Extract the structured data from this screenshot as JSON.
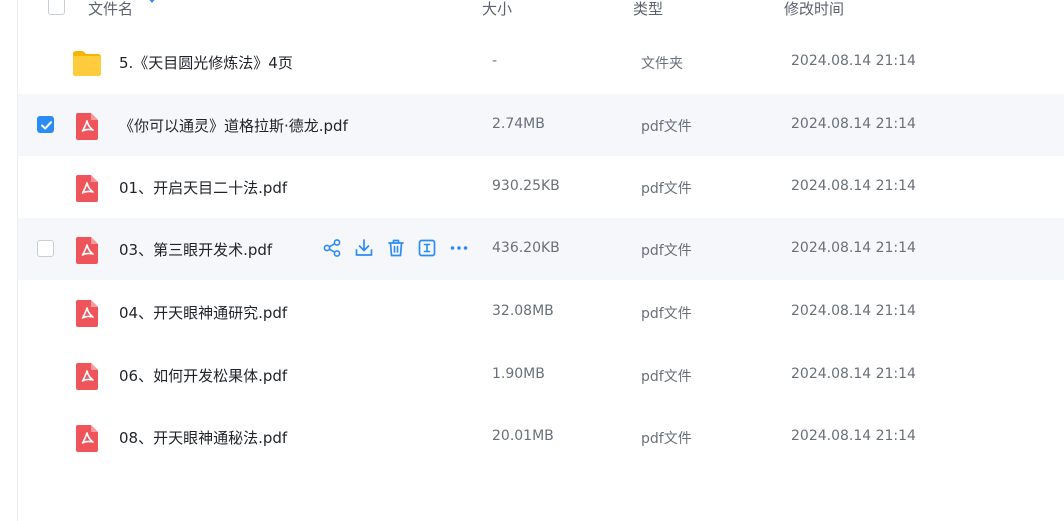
{
  "header": {
    "name_label": "文件名",
    "size_label": "大小",
    "type_label": "类型",
    "time_label": "修改时间"
  },
  "colors": {
    "accent": "#2b8cf6",
    "pdf_red": "#f0545b",
    "folder_yellow": "#ffc93d",
    "row_highlight": "#f5f7fa"
  },
  "files": [
    {
      "icon": "folder-icon",
      "name": "5.《天目圆光修炼法》4页",
      "size": "-",
      "type": "文件夹",
      "time": "2024.08.14 21:14",
      "checked": false
    },
    {
      "icon": "pdf-icon",
      "name": "《你可以通灵》道格拉斯·德龙.pdf",
      "size": "2.74MB",
      "type": "pdf文件",
      "time": "2024.08.14 21:14",
      "checked": true
    },
    {
      "icon": "pdf-icon",
      "name": "01、开启天目二十法.pdf",
      "size": "930.25KB",
      "type": "pdf文件",
      "time": "2024.08.14 21:14",
      "checked": false
    },
    {
      "icon": "pdf-icon",
      "name": "03、第三眼开发术.pdf",
      "size": "436.20KB",
      "type": "pdf文件",
      "time": "2024.08.14 21:14",
      "checked": false,
      "hovered": true
    },
    {
      "icon": "pdf-icon",
      "name": "04、开天眼神通研究.pdf",
      "size": "32.08MB",
      "type": "pdf文件",
      "time": "2024.08.14 21:14",
      "checked": false
    },
    {
      "icon": "pdf-icon",
      "name": "06、如何开发松果体.pdf",
      "size": "1.90MB",
      "type": "pdf文件",
      "time": "2024.08.14 21:14",
      "checked": false
    },
    {
      "icon": "pdf-icon",
      "name": "08、开天眼神通秘法.pdf",
      "size": "20.01MB",
      "type": "pdf文件",
      "time": "2024.08.14 21:14",
      "checked": false
    }
  ],
  "row_actions": [
    "share-icon",
    "download-icon",
    "delete-icon",
    "rename-icon",
    "more-icon"
  ]
}
